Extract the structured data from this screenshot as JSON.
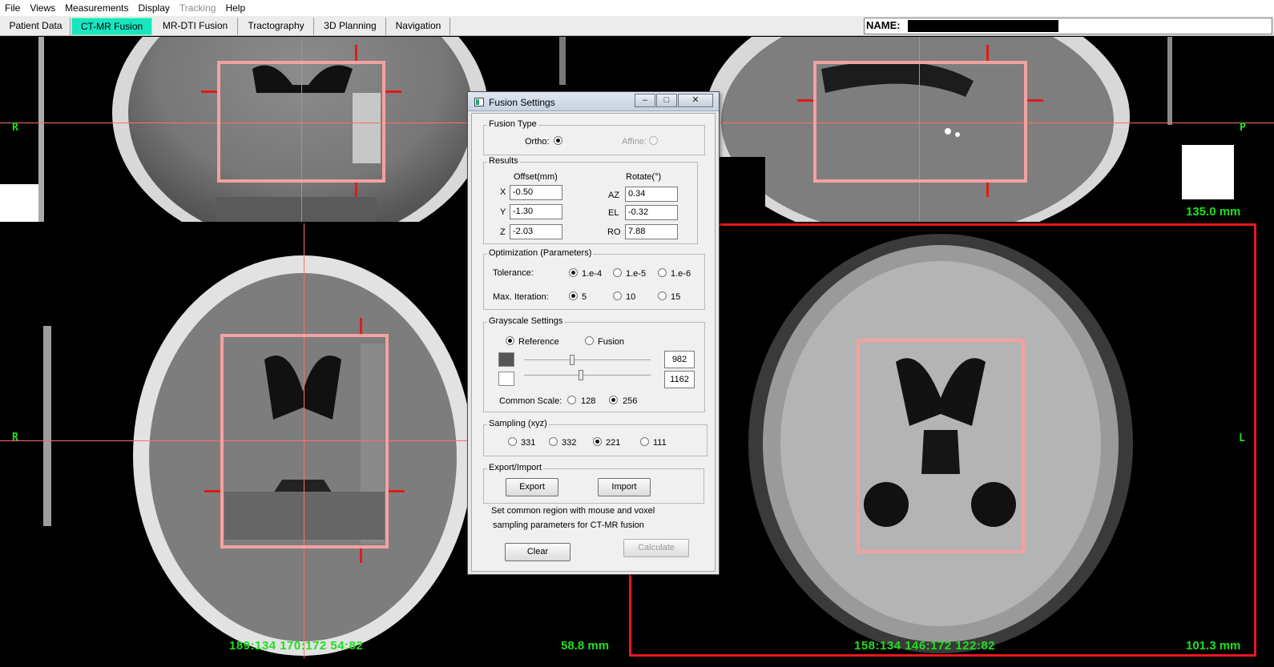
{
  "menu": {
    "items": [
      "File",
      "Views",
      "Measurements",
      "Display",
      "Tracking",
      "Help"
    ],
    "disabled": [
      "Tracking"
    ]
  },
  "tabs": [
    "Patient Data",
    "CT-MR Fusion",
    "MR-DTI Fusion",
    "Tractography",
    "3D Planning",
    "Navigation"
  ],
  "active_tab": "CT-MR Fusion",
  "name_field": {
    "label": "NAME:",
    "value": ""
  },
  "views": {
    "coronal": {
      "left_label": "R"
    },
    "sagittal": {
      "right_label": "P",
      "scale": "135.0 mm"
    },
    "axial_ct": {
      "left_label": "R",
      "coords": "189:134  170:172  54:82",
      "scale": "58.8 mm"
    },
    "axial_mr": {
      "right_label": "L",
      "coords": "158:134  146:172  122:82",
      "scale": "101.3 mm"
    }
  },
  "dialog": {
    "title": "Fusion Settings",
    "fusion_type": {
      "title": "Fusion Type",
      "ortho": "Ortho:",
      "affine": "Affine:",
      "selected": "Ortho"
    },
    "results": {
      "title": "Results",
      "offset_header": "Offset(mm)",
      "rotate_header": "Rotate(°)",
      "rows": [
        {
          "axis": "X",
          "offset": "-0.50",
          "rot_label": "AZ",
          "rotate": "0.34"
        },
        {
          "axis": "Y",
          "offset": "-1.30",
          "rot_label": "EL",
          "rotate": "-0.32"
        },
        {
          "axis": "Z",
          "offset": "-2.03",
          "rot_label": "RO",
          "rotate": "7.88"
        }
      ]
    },
    "optimization": {
      "title": "Optimization (Parameters)",
      "tolerance_label": "Tolerance:",
      "tolerance_options": [
        "1.e-4",
        "1.e-5",
        "1.e-6"
      ],
      "tolerance_selected": "1.e-4",
      "iteration_label": "Max. Iteration:",
      "iteration_options": [
        "5",
        "10",
        "15"
      ],
      "iteration_selected": "5"
    },
    "grayscale": {
      "title": "Grayscale Settings",
      "mode_options": [
        "Reference",
        "Fusion"
      ],
      "mode_selected": "Reference",
      "slider1_value": "982",
      "slider2_value": "1162",
      "slider1_level": 0.38,
      "slider2_level": 0.45,
      "swatch1_color": "#555555",
      "swatch2_color": "#ffffff",
      "common_scale_label": "Common Scale:",
      "scale_options": [
        "128",
        "256"
      ],
      "scale_selected": "256"
    },
    "sampling": {
      "title": "Sampling (xyz)",
      "options": [
        "331",
        "332",
        "221",
        "111"
      ],
      "selected": "221"
    },
    "export_import": {
      "title": "Export/Import",
      "export_label": "Export",
      "import_label": "Import"
    },
    "note_line1": "Set common region with mouse and voxel",
    "note_line2": "sampling parameters for CT-MR fusion",
    "clear_label": "Clear",
    "calculate_label": "Calculate"
  },
  "colors": {
    "overlay_green": "#1ee01e",
    "roi_pink": "#f4a1a1",
    "crosshair": "#ff6d6d",
    "active_view_border": "#e8181e",
    "active_tab": "#18e6c0"
  }
}
